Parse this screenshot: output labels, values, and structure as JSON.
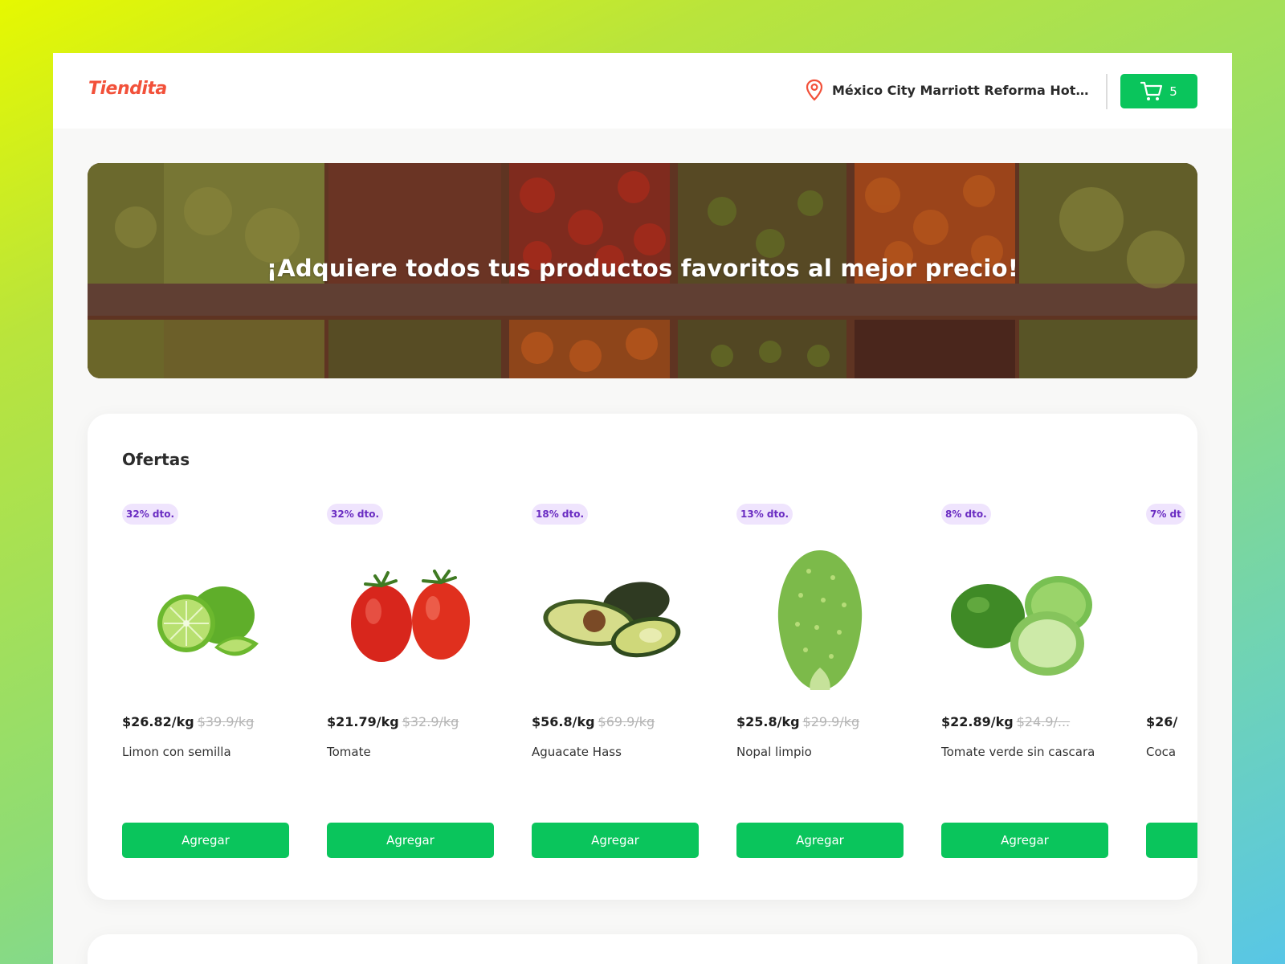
{
  "header": {
    "brand": "Tiendita",
    "location": "México City Marriott Reforma Hotel...",
    "cart_count": "5"
  },
  "hero": {
    "title": "¡Adquiere todos tus productos favoritos al mejor precio!"
  },
  "offers": {
    "title": "Ofertas",
    "add_label": "Agregar",
    "products": [
      {
        "discount": "32% dto.",
        "price": "$26.82/kg",
        "old_price": "$39.9/kg",
        "name": "Limon con semilla",
        "image": "lime-icon"
      },
      {
        "discount": "32% dto.",
        "price": "$21.79/kg",
        "old_price": "$32.9/kg",
        "name": "Tomate",
        "image": "tomato-icon"
      },
      {
        "discount": "18% dto.",
        "price": "$56.8/kg",
        "old_price": "$69.9/kg",
        "name": "Aguacate Hass",
        "image": "avocado-icon"
      },
      {
        "discount": "13% dto.",
        "price": "$25.8/kg",
        "old_price": "$29.9/kg",
        "name": "Nopal limpio",
        "image": "nopal-icon"
      },
      {
        "discount": "8% dto.",
        "price": "$22.89/kg",
        "old_price": "$24.9/...",
        "name": "Tomate verde sin cascara",
        "image": "tomatillo-icon"
      },
      {
        "discount": "7% dt",
        "price": "$26/",
        "old_price": "",
        "name": "Coca",
        "image": ""
      }
    ]
  },
  "colors": {
    "brand": "#f2513a",
    "accent_green": "#0ac55c",
    "badge_bg": "#efe4fd",
    "badge_text": "#6a2cc2"
  }
}
